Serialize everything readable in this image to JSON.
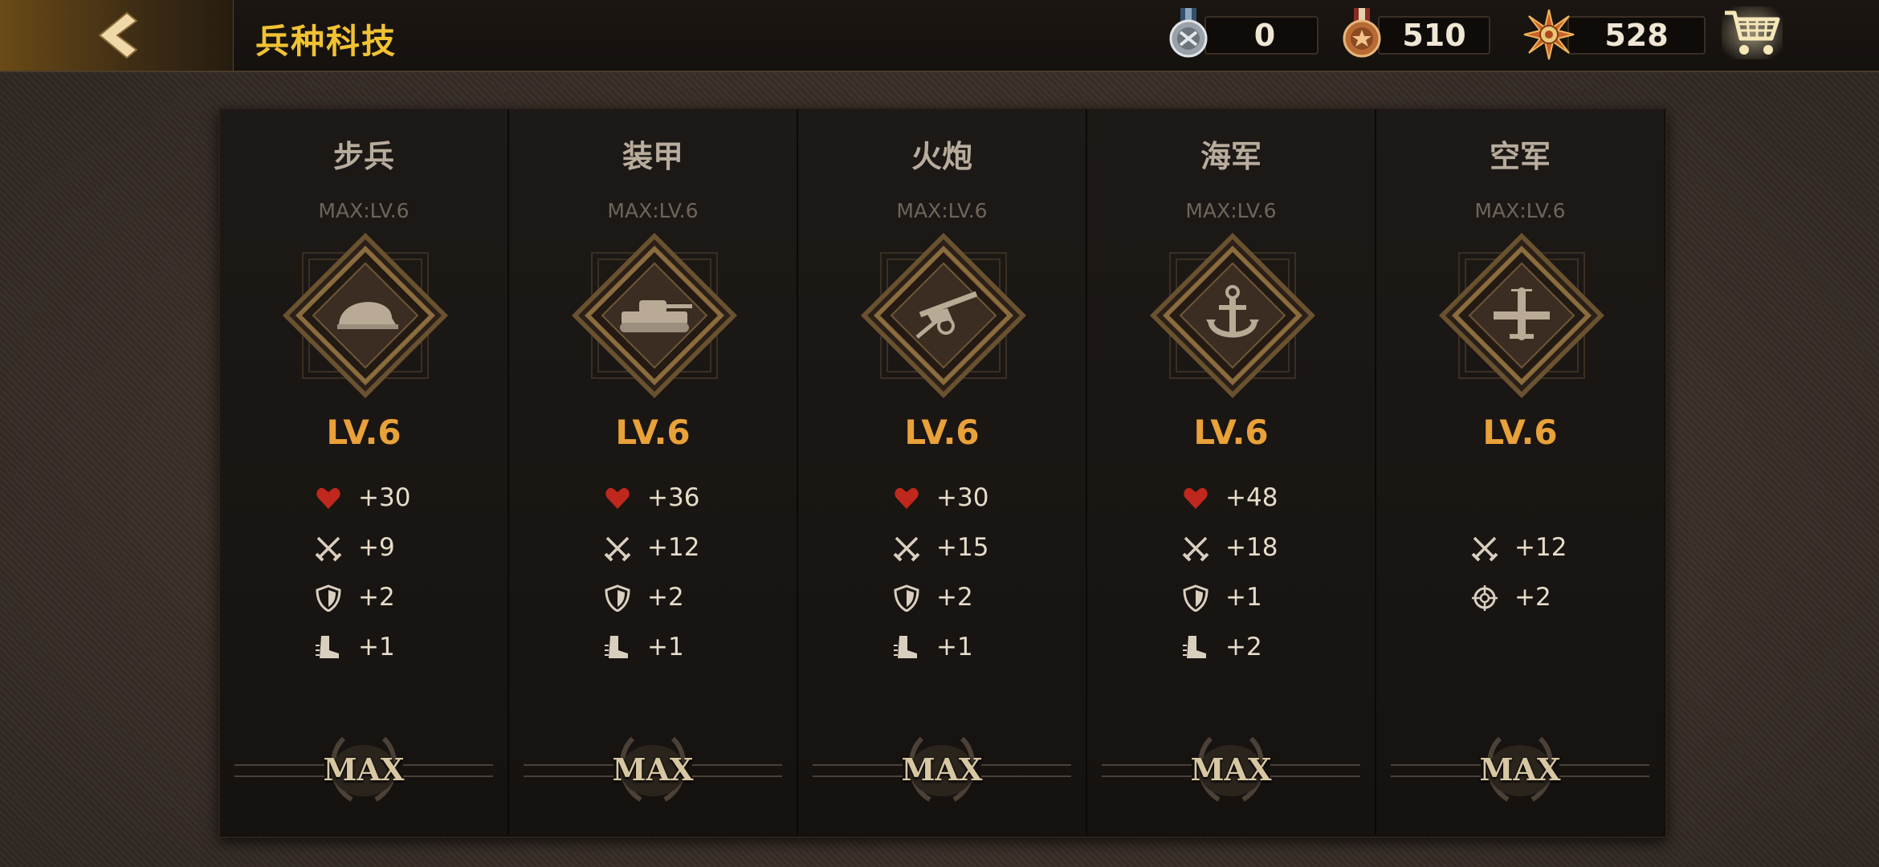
{
  "header": {
    "title": "兵种科技",
    "resources": [
      {
        "name": "silver-medal",
        "value": "0"
      },
      {
        "name": "bronze-medal",
        "value": "510"
      },
      {
        "name": "star-badge",
        "value": "528"
      }
    ]
  },
  "colors": {
    "accent": "#f1c232",
    "level": "#e9a13a",
    "heart": "#c0281d"
  },
  "branches": [
    {
      "name": "步兵",
      "max": "MAX:LV.6",
      "icon": "helmet-icon",
      "level": "LV.6",
      "stats": [
        {
          "icon": "heart-icon",
          "value": "+30"
        },
        {
          "icon": "swords-icon",
          "value": "+9"
        },
        {
          "icon": "shield-icon",
          "value": "+2"
        },
        {
          "icon": "boot-icon",
          "value": "+1"
        }
      ],
      "button": "MAX"
    },
    {
      "name": "装甲",
      "max": "MAX:LV.6",
      "icon": "tank-icon",
      "level": "LV.6",
      "stats": [
        {
          "icon": "heart-icon",
          "value": "+36"
        },
        {
          "icon": "swords-icon",
          "value": "+12"
        },
        {
          "icon": "shield-icon",
          "value": "+2"
        },
        {
          "icon": "boot-icon",
          "value": "+1"
        }
      ],
      "button": "MAX"
    },
    {
      "name": "火炮",
      "max": "MAX:LV.6",
      "icon": "cannon-icon",
      "level": "LV.6",
      "stats": [
        {
          "icon": "heart-icon",
          "value": "+30"
        },
        {
          "icon": "swords-icon",
          "value": "+15"
        },
        {
          "icon": "shield-icon",
          "value": "+2"
        },
        {
          "icon": "boot-icon",
          "value": "+1"
        }
      ],
      "button": "MAX"
    },
    {
      "name": "海军",
      "max": "MAX:LV.6",
      "icon": "anchor-icon",
      "level": "LV.6",
      "stats": [
        {
          "icon": "heart-icon",
          "value": "+48"
        },
        {
          "icon": "swords-icon",
          "value": "+18"
        },
        {
          "icon": "shield-icon",
          "value": "+1"
        },
        {
          "icon": "boot-icon",
          "value": "+2"
        }
      ],
      "button": "MAX"
    },
    {
      "name": "空军",
      "max": "MAX:LV.6",
      "icon": "plane-icon",
      "level": "LV.6",
      "stats": [
        {
          "icon": "swords-icon",
          "value": "+12"
        },
        {
          "icon": "crosshair-icon",
          "value": "+2"
        }
      ],
      "button": "MAX"
    }
  ]
}
